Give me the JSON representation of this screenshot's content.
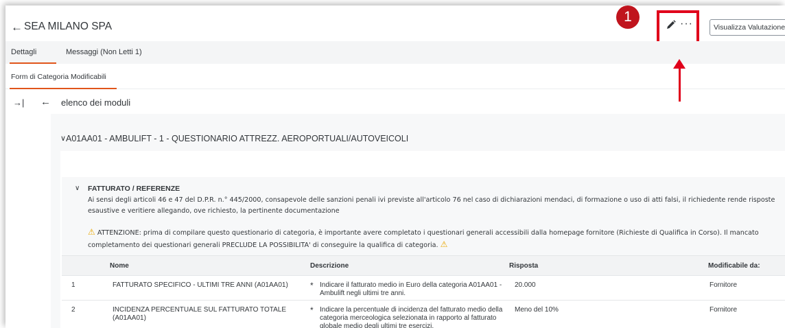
{
  "header": {
    "title": "SEA MILANO SPA",
    "step_badge": "1",
    "view_button": "Visualizza Valutazione"
  },
  "tabs": [
    {
      "label": "Dettagli",
      "selected": true
    },
    {
      "label": "Messaggi (Non Letti 1)",
      "selected": false
    }
  ],
  "subtab": {
    "label": "Form di Categoria Modificabili"
  },
  "nav": {
    "label": "elenco dei moduli"
  },
  "section": {
    "title": "A01AA01 - AMBULIFT - 1 - QUESTIONARIO ATTREZZ. AEROPORTUALI/AUTOVEICOLI"
  },
  "group": {
    "title": "FATTURATO / REFERENZE",
    "description": "Ai sensi degli articoli 46 e 47 del D.P.R. n.° 445/2000, consapevole delle sanzioni penali ivi previste all'articolo 76 nel caso di dichiarazioni mendaci, di formazione o uso di atti falsi, il richiedente rende risposte esaustive e veritiere allegando, ove richiesto, la pertinente documentazione",
    "warning": "ATTENZIONE: prima di compilare questo questionario di categoria, è importante avere completato i questionari generali accessibili dalla homepage fornitore (Richieste di Qualifica in Corso). Il mancato completamento dei questionari generali PRECLUDE LA POSSIBILITA' di conseguire la qualifica di categoria."
  },
  "table": {
    "columns": [
      "Nome",
      "Descrizione",
      "Risposta",
      "Modificabile da:"
    ],
    "rows": [
      {
        "num": "1",
        "nome": "FATTURATO SPECIFICO - ULTIMI TRE ANNI (A01AA01)",
        "descrizione": "Indicare il fatturato medio in Euro della categoria A01AA01 - Ambulift negli ultimi tre anni.",
        "risposta": "20.000",
        "modificabile": "Fornitore"
      },
      {
        "num": "2",
        "nome": "INCIDENZA PERCENTUALE SUL FATTURATO TOTALE (A01AA01)",
        "descrizione": "Indicare la percentuale di incidenza del fatturato medio della categoria merceologica selezionata in rapporto al fatturato globale medio degli ultimi tre esercizi.",
        "risposta": "Meno del 10%",
        "modificabile": "Fornitore"
      }
    ]
  },
  "colors": {
    "accent": "#e0551a",
    "annotation_red": "#e0001b",
    "badge_red": "#c0141d",
    "warning_yellow": "#e9a700"
  }
}
